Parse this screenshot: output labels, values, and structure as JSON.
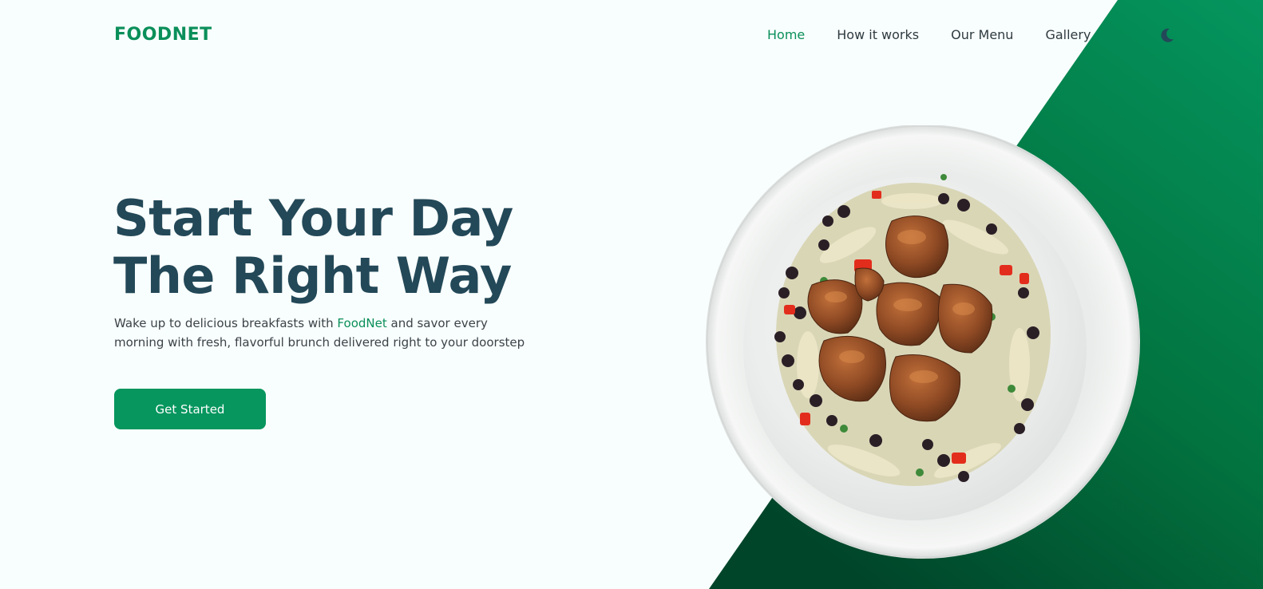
{
  "brand": {
    "name": "FOODNET",
    "color": "#0b8f5a"
  },
  "nav": {
    "items": [
      {
        "label": "Home",
        "active": true
      },
      {
        "label": "How it works",
        "active": false
      },
      {
        "label": "Our Menu",
        "active": false
      },
      {
        "label": "Gallery",
        "active": false
      }
    ],
    "theme_icon": "moon-icon"
  },
  "hero": {
    "title_line1": "Start Your Day",
    "title_line2": "The Right Way",
    "subtitle_before": "Wake up to delicious breakfasts with ",
    "subtitle_brand": "FoodNet",
    "subtitle_after": " and savor every morning with fresh, flavorful brunch delivered right to your doorstep",
    "cta_label": "Get Started"
  },
  "hero_image": {
    "icon": "food-plate-image"
  },
  "colors": {
    "accent": "#06965e",
    "title": "#234858",
    "background": "#f8fefd",
    "green_dark": "#00452a",
    "green_light": "#05955e"
  }
}
